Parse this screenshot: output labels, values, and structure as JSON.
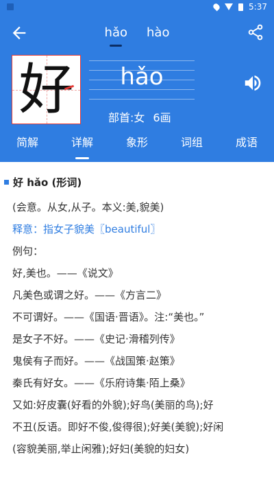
{
  "status": {
    "time": "5:37"
  },
  "toolbar": {
    "pinyin_tabs": [
      {
        "label": "hǎo",
        "active": true
      },
      {
        "label": "hào",
        "active": false
      }
    ]
  },
  "character": {
    "glyph": "好",
    "pinyin": "hǎo",
    "radical_label": "部首:女",
    "strokes_label": "6画"
  },
  "sections": [
    {
      "label": "简解",
      "active": false
    },
    {
      "label": "详解",
      "active": true
    },
    {
      "label": "象形",
      "active": false
    },
    {
      "label": "词组",
      "active": false
    },
    {
      "label": "成语",
      "active": false
    }
  ],
  "detail": {
    "heading": "好  hǎo (形词)",
    "lines": [
      "(会意。从女,从子。本义:美,貌美)",
      "释意：指女子貌美〖beautiful〗",
      "例句：",
      "好,美也。——《说文》",
      "凡美色或谓之好。——《方言二》",
      "不可谓好。——《国语·晋语》。注:“美也。”",
      "是女子不好。——《史记·滑稽列传》",
      "鬼侯有子而好。——《战国策·赵策》",
      "秦氏有好女。——《乐府诗集·陌上桑》",
      "又如:好皮囊(好看的外貌);好鸟(美丽的鸟);好",
      "不丑(反语。即好不俊,俊得很);好美(美貌);好闲",
      "(容貌美丽,举止闲雅);好妇(美貌的妇女)"
    ]
  },
  "colors": {
    "primary": "#2f7de1",
    "accent_red": "#e53935"
  }
}
